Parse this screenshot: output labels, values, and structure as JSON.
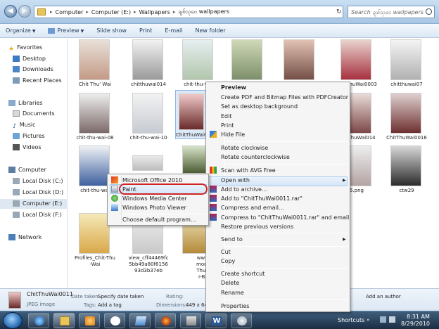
{
  "address": {
    "crumbs": [
      "Computer",
      "Computer (E:)",
      "Wallpapers",
      "ချစ်သုဝေ wallpapers"
    ],
    "search_placeholder": "Search ချစ်သုဝေ wallpapers"
  },
  "toolbar": {
    "organize": "Organize",
    "preview": "Preview",
    "slideshow": "Slide show",
    "print": "Print",
    "email": "E-mail",
    "newfolder": "New folder"
  },
  "nav": {
    "favorites": "Favorites",
    "desktop": "Desktop",
    "downloads": "Downloads",
    "recent": "Recent Places",
    "libraries": "Libraries",
    "documents": "Documents",
    "music": "Music",
    "pictures": "Pictures",
    "videos": "Videos",
    "computer": "Computer",
    "disk_c": "Local Disk (C:)",
    "disk_d": "Local Disk (D:)",
    "disk_e": "Computer  (E:)",
    "disk_f": "Local Disk (F:)",
    "network": "Network"
  },
  "files": {
    "f1": "Chit Thu' Wai",
    "f2": "chitthuwai014",
    "f3": "chit-thu-wai",
    "f7": "ChitThuWai0003",
    "f8": "chitthuwai07",
    "f9": "chit-thu-wai-08",
    "f10": "chit-thu-wai-10",
    "f11": "ChitThuWai0011",
    "f14": "ChitThuWai014",
    "f15": "ChitThuWai0016",
    "f16": "chit-thu-wai",
    "f20": "5.png",
    "f21": "ctw29",
    "f22a": "Profiles_Chit-Thu",
    "f22b": "-Wai",
    "f23a": "view_cff44469fc",
    "f23b": "5bb49a80f6156",
    "f23c": "93d3b37eb",
    "f24a": "www.myan",
    "f24b": "model.com_",
    "f24c": "Thu-Wai-Su",
    "f24d": "r-Breeze-("
  },
  "context_menu": {
    "preview": "Preview",
    "pdf": "Create PDF and Bitmap Files with PDFCreator",
    "background": "Set as desktop background",
    "edit": "Edit",
    "print": "Print",
    "hide": "Hide File",
    "rot_cw": "Rotate clockwise",
    "rot_ccw": "Rotate counterclockwise",
    "avg": "Scan with AVG Free",
    "openwith": "Open with",
    "archive": "Add to archive...",
    "rar": "Add to \"ChitThuWai0011.rar\"",
    "compress_email": "Compress and email...",
    "compress_rar_email": "Compress to \"ChitThuWai0011.rar\" and email",
    "restore": "Restore previous versions",
    "sendto": "Send to",
    "cut": "Cut",
    "copy": "Copy",
    "shortcut": "Create shortcut",
    "delete": "Delete",
    "rename": "Rename",
    "properties": "Properties"
  },
  "submenu": {
    "office": "Microsoft Office 2010",
    "paint": "Paint",
    "wmc": "Windows Media Center",
    "wpv": "Windows Photo Viewer",
    "default": "Choose default program..."
  },
  "details": {
    "name": "ChitThuWai0011",
    "type": "JPEG image",
    "date_label": "Date taken:",
    "date_value": "Specify date taken",
    "tags_label": "Tags:",
    "tags_value": "Add a tag",
    "rating_label": "Rating:",
    "dims_label": "Dimensions:",
    "dims_value": "449 x 640",
    "authors": "Add an author"
  },
  "taskbar": {
    "shortcuts": "Shortcuts",
    "time": "8:31 AM",
    "date": "8/29/2010"
  },
  "colors": {
    "accent": "#d02525",
    "highlight": "#d5e6f8"
  }
}
